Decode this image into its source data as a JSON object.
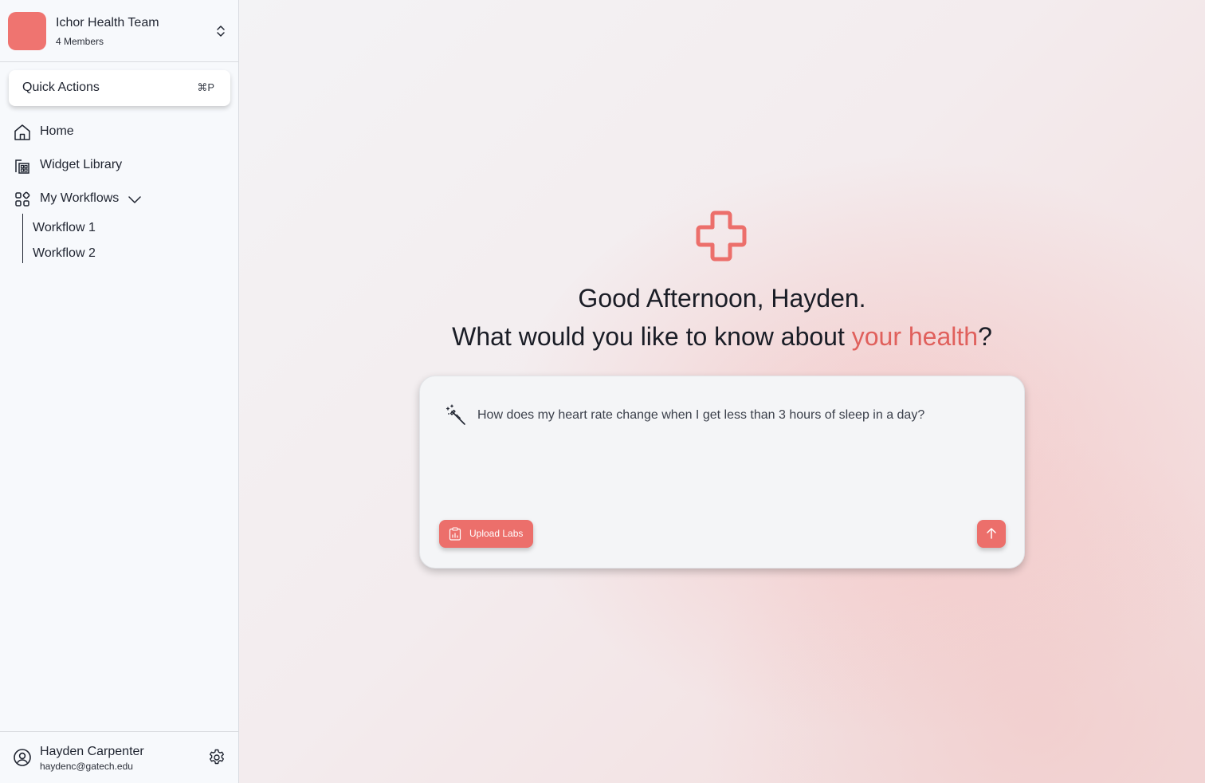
{
  "team": {
    "name": "Ichor Health Team",
    "members": "4 Members",
    "avatar_color": "#ef7470"
  },
  "quick_actions": {
    "label": "Quick Actions",
    "shortcut": "⌘P"
  },
  "nav": {
    "home": "Home",
    "widget_library": "Widget Library",
    "my_workflows": "My Workflows",
    "workflows": [
      "Workflow 1",
      "Workflow 2"
    ]
  },
  "user": {
    "name": "Hayden Carpenter",
    "email": "haydenc@gatech.edu"
  },
  "main": {
    "greeting": "Good Afternoon, Hayden.",
    "question_prefix": "What would you like to know about ",
    "question_accent": "your health",
    "question_suffix": "?",
    "prompt_text": "How does my heart rate change when I get less than 3 hours of sleep in a day?",
    "upload_label": "Upload Labs"
  },
  "colors": {
    "accent": "#ec6f6b",
    "accent_text": "#e0605c"
  },
  "icons": {
    "team_switch": "chevron-up-down-icon",
    "home": "home-icon",
    "widget_library": "widget-library-icon",
    "workflows": "workflows-icon",
    "user": "user-circle-icon",
    "settings": "gear-icon",
    "logo": "medical-cross-icon",
    "prompt": "magic-wand-icon",
    "upload": "clipboard-icon",
    "send": "arrow-up-icon"
  }
}
